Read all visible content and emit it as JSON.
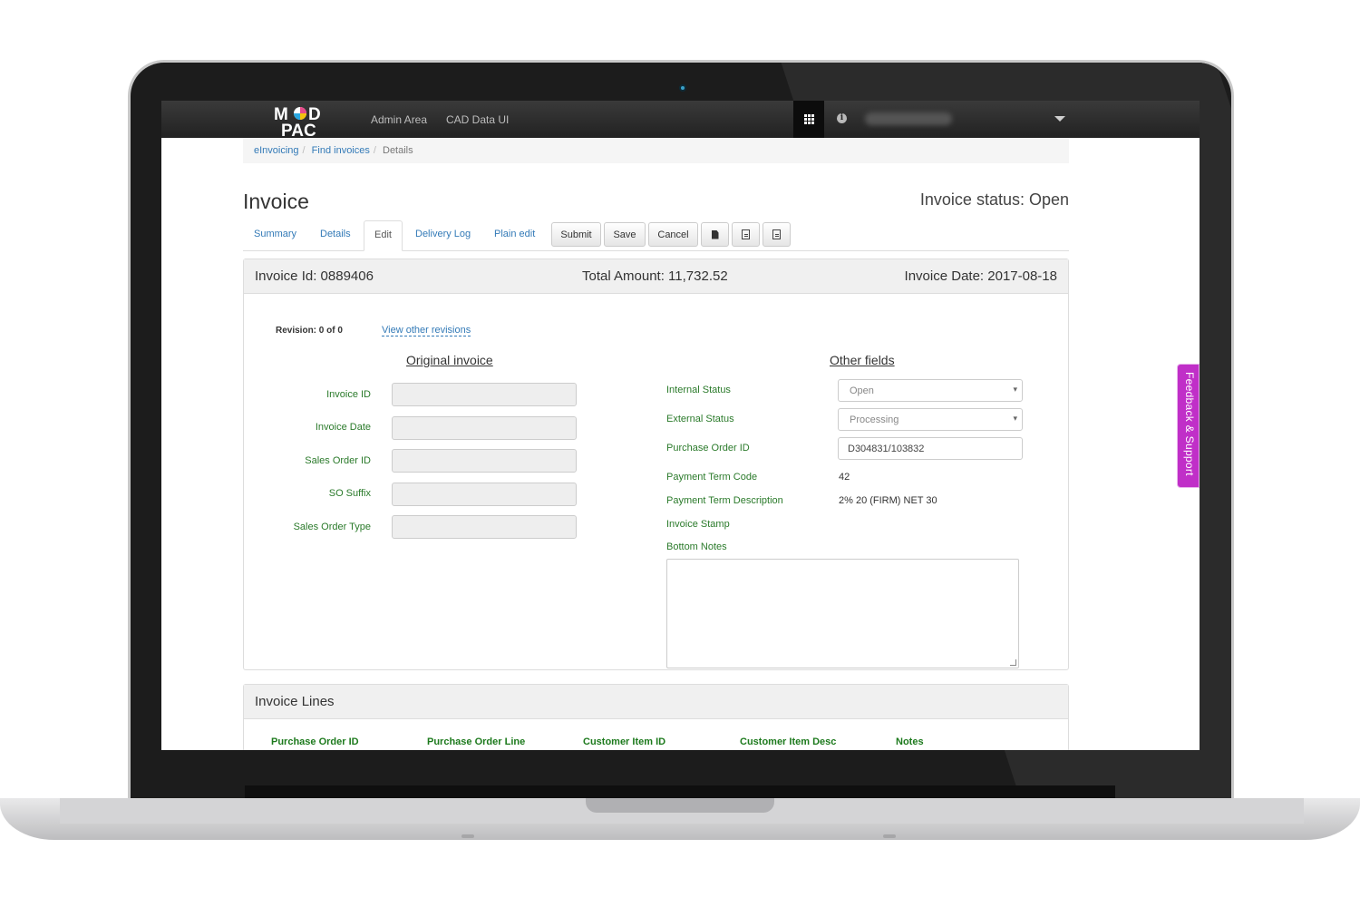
{
  "navbar": {
    "logo_text": "MOD PAC",
    "links": [
      "Admin Area",
      "CAD Data UI"
    ]
  },
  "breadcrumb": {
    "items": [
      "eInvoicing",
      "Find invoices",
      "Details"
    ]
  },
  "page": {
    "title": "Invoice",
    "status": "Invoice status: Open"
  },
  "tabs": [
    "Summary",
    "Details",
    "Edit",
    "Delivery Log",
    "Plain edit"
  ],
  "actions": {
    "submit": "Submit",
    "save": "Save",
    "cancel": "Cancel"
  },
  "summary": {
    "invoice_id": "Invoice Id: 0889406",
    "total_amount": "Total Amount: 11,732.52",
    "invoice_date": "Invoice Date: 2017-08-18"
  },
  "revision": {
    "label": "Revision: 0 of 0",
    "link": "View other revisions"
  },
  "original_invoice": {
    "title": "Original invoice",
    "fields": [
      "Invoice ID",
      "Invoice Date",
      "Sales Order ID",
      "SO Suffix",
      "Sales Order Type"
    ]
  },
  "other_fields": {
    "title": "Other fields",
    "internal_status_label": "Internal Status",
    "internal_status_value": "Open",
    "external_status_label": "External Status",
    "external_status_value": "Processing",
    "po_label": "Purchase Order ID",
    "po_value": "D304831/103832",
    "payment_term_code_label": "Payment Term Code",
    "payment_term_code_value": "42",
    "payment_term_desc_label": "Payment Term Description",
    "payment_term_desc_value": "2% 20 (FIRM) NET 30",
    "invoice_stamp_label": "Invoice Stamp",
    "bottom_notes_label": "Bottom Notes"
  },
  "invoice_lines": {
    "title": "Invoice Lines",
    "columns": [
      "Purchase Order ID",
      "Purchase Order Line",
      "Customer Item ID",
      "Customer Item Desc",
      "Notes"
    ]
  },
  "feedback": "Feedback & Support",
  "colors": {
    "link": "#337ab7",
    "label_green": "#2a7a2a",
    "feedback": "#c02fc8"
  }
}
